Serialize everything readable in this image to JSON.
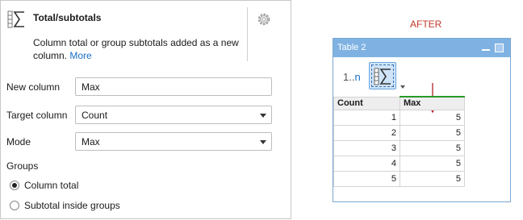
{
  "panel": {
    "title": "Total/subtotals",
    "description": "Column total or group subtotals added as a new column.",
    "more_link": "More",
    "icon": "sigma-column-icon",
    "settings_icon": "gear-icon"
  },
  "form": {
    "new_column_label": "New column",
    "new_column_value": "Max",
    "target_column_label": "Target column",
    "target_column_value": "Count",
    "mode_label": "Mode",
    "mode_value": "Max",
    "groups_label": "Groups",
    "group_options": [
      "Column total",
      "Subtotal inside groups"
    ],
    "group_selected": "Column total"
  },
  "preview": {
    "after_label": "AFTER",
    "window_title": "Table 2",
    "toolbar_text_prefix": "1..",
    "toolbar_text_suffix": "n",
    "columns": [
      "Count",
      "Max"
    ],
    "rows": [
      [
        "1",
        "5"
      ],
      [
        "2",
        "5"
      ],
      [
        "3",
        "5"
      ],
      [
        "4",
        "5"
      ],
      [
        "5",
        "5"
      ]
    ],
    "accent_new_column": "#2a9a2a",
    "arrow_color": "#b22222"
  }
}
